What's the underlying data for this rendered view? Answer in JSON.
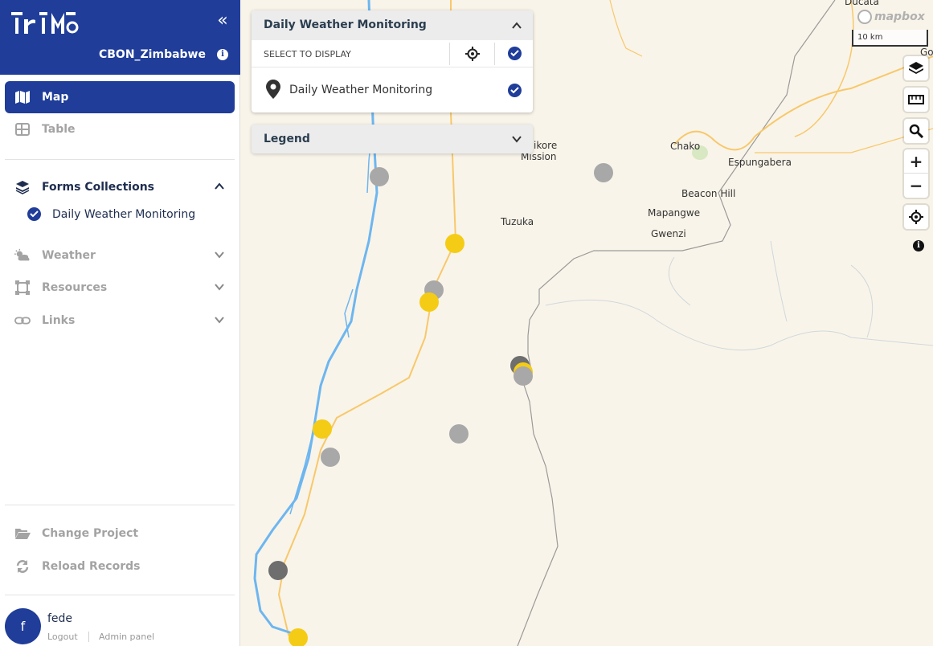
{
  "app": {
    "logo_text": "iriM",
    "project_name": "CBON_Zimbabwe",
    "collapse_icon": "double-chevron-left-icon",
    "info_icon": "info-icon"
  },
  "nav": {
    "map": {
      "label": "Map",
      "icon": "map-icon",
      "active": true
    },
    "table": {
      "label": "Table",
      "icon": "table-icon"
    }
  },
  "forms": {
    "label": "Forms Collections",
    "icon": "layers-icon",
    "expanded": true,
    "items": [
      {
        "label": "Daily Weather Monitoring",
        "checked": true
      }
    ]
  },
  "sections": {
    "weather": {
      "label": "Weather",
      "icon": "weather-icon"
    },
    "resources": {
      "label": "Resources",
      "icon": "vector-square-icon"
    },
    "links": {
      "label": "Links",
      "icon": "link-icon"
    }
  },
  "footer_actions": {
    "change_project": {
      "label": "Change Project",
      "icon": "folder-open-icon"
    },
    "reload_records": {
      "label": "Reload Records",
      "icon": "reload-icon"
    }
  },
  "user": {
    "initial": "f",
    "name": "fede",
    "logout": "Logout",
    "admin": "Admin panel"
  },
  "monitor_panel": {
    "title": "Daily Weather Monitoring",
    "select_label": "SELECT TO DISPLAY",
    "layer_label": "Daily Weather Monitoring",
    "all_checked": true,
    "layer_checked": true
  },
  "legend_panel": {
    "title": "Legend"
  },
  "map": {
    "attribution": "mapbox",
    "scale_label": "10 km",
    "places": {
      "chikore": "Chikore",
      "mission": "Mission",
      "tuzuka": "Tuzuka",
      "chako": "Chako",
      "espungabera": "Espungabera",
      "beacon_hill": "Beacon Hill",
      "mapangwe": "Mapangwe",
      "gwenzi": "Gwenzi",
      "ducata": "Ducata",
      "go": "Go"
    },
    "marker_colors": {
      "sunny": "#f5cc15",
      "cloudy": "#a8a8a8",
      "overcast": "#6e6e6e"
    }
  },
  "colors": {
    "brand": "#1f3d99",
    "river": "#6db6f0",
    "road": "#f7c86b",
    "border": "#9a9a9a",
    "land": "#f9f4e9"
  }
}
